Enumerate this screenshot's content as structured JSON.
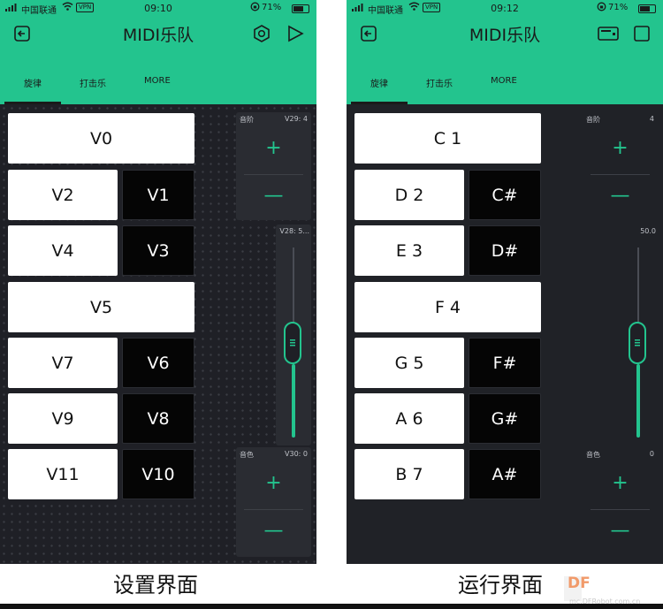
{
  "setup": {
    "status": {
      "carrier": "中国联通",
      "vpn": "VPN",
      "time": "09:10",
      "battery": "71%"
    },
    "title": "MIDI乐队",
    "tabs": [
      "旋律",
      "打击乐",
      "MORE"
    ],
    "keys": {
      "k0": "V0",
      "k2": "V2",
      "k1": "V1",
      "k4": "V4",
      "k3": "V3",
      "k5": "V5",
      "k7": "V7",
      "k6": "V6",
      "k9": "V9",
      "k8": "V8",
      "k11": "V11",
      "k10": "V10"
    },
    "scale_stepper": {
      "label": "音阶",
      "value": "V29: 4",
      "plus": "+",
      "minus": "—"
    },
    "slider": {
      "value": "V28: 5..."
    },
    "tone_stepper": {
      "label": "音色",
      "value": "V30: 0",
      "plus": "+",
      "minus": "—"
    },
    "caption": "设置界面"
  },
  "run": {
    "status": {
      "carrier": "中国联通",
      "vpn": "VPN",
      "time": "09:12",
      "battery": "71%"
    },
    "title": "MIDI乐队",
    "tabs": [
      "旋律",
      "打击乐",
      "MORE"
    ],
    "keys": {
      "k0": "C 1",
      "k2": "D 2",
      "k1": "C#",
      "k4": "E 3",
      "k3": "D#",
      "k5": "F 4",
      "k7": "G 5",
      "k6": "F#",
      "k9": "A 6",
      "k8": "G#",
      "k11": "B 7",
      "k10": "A#"
    },
    "scale_stepper": {
      "label": "音阶",
      "value": "4",
      "plus": "+",
      "minus": "—"
    },
    "slider": {
      "value": "50.0",
      "level": 0.5
    },
    "tone_stepper": {
      "label": "音色",
      "value": "0",
      "plus": "+",
      "minus": "—"
    },
    "caption": "运行界面"
  },
  "watermark": {
    "logo": "DF",
    "site": "mc.DFRobot.com.cn"
  },
  "colors": {
    "accent": "#23c48e",
    "background": "#1f2026"
  }
}
